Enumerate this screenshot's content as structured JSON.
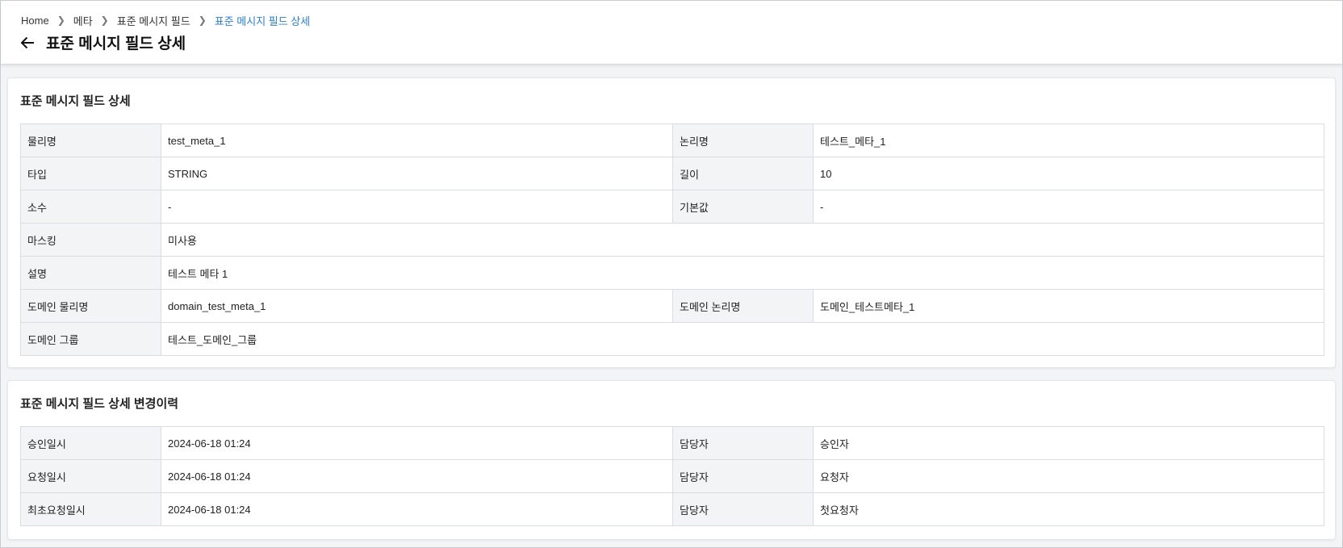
{
  "breadcrumb": {
    "home": "Home",
    "level1": "메타",
    "level2": "표준 메시지 필드",
    "current": "표준 메시지 필드 상세"
  },
  "page": {
    "title": "표준 메시지 필드 상세"
  },
  "detail": {
    "title": "표준 메시지 필드 상세",
    "physical_name_label": "물리명",
    "physical_name": "test_meta_1",
    "logical_name_label": "논리명",
    "logical_name": "테스트_메타_1",
    "type_label": "타입",
    "type": "STRING",
    "length_label": "길이",
    "length": "10",
    "decimal_label": "소수",
    "decimal": "-",
    "default_label": "기본값",
    "default": "-",
    "masking_label": "마스킹",
    "masking": "미사용",
    "description_label": "설명",
    "description": "테스트 메타 1",
    "domain_physical_label": "도메인 물리명",
    "domain_physical": "domain_test_meta_1",
    "domain_logical_label": "도메인 논리명",
    "domain_logical": "도메인_테스트메타_1",
    "domain_group_label": "도메인 그룹",
    "domain_group": "테스트_도메인_그룹"
  },
  "history": {
    "title": "표준 메시지 필드 상세 변경이력",
    "rows": [
      {
        "date_label": "승인일시",
        "date": "2024-06-18 01:24",
        "owner_label": "담당자",
        "owner": "승인자"
      },
      {
        "date_label": "요청일시",
        "date": "2024-06-18 01:24",
        "owner_label": "담당자",
        "owner": "요청자"
      },
      {
        "date_label": "최초요청일시",
        "date": "2024-06-18 01:24",
        "owner_label": "담당자",
        "owner": "첫요청자"
      }
    ]
  }
}
